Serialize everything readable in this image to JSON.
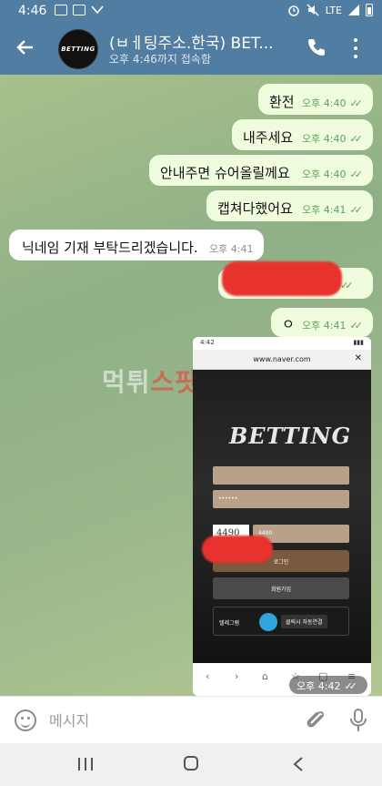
{
  "status_bar": {
    "time": "4:46",
    "network": "LTE",
    "icons": [
      "image-icon",
      "video-icon",
      "missed-call-icon",
      "alarm-icon",
      "mute-icon",
      "signal-icon",
      "battery-icon"
    ]
  },
  "header": {
    "title": "(ㅂㅔ팅주소.한국) BET...",
    "subtitle": "오후 4:46까지 접속함",
    "avatar_text": "BETTING",
    "accent": "#517da2"
  },
  "messages": [
    {
      "direction": "out",
      "text": "환전",
      "time": "오후 4:40",
      "read": true
    },
    {
      "direction": "out",
      "text": "내주세요",
      "time": "오후 4:40",
      "read": true
    },
    {
      "direction": "out",
      "text": "안내주면 슈어올릴께요",
      "time": "오후 4:40",
      "read": true
    },
    {
      "direction": "out",
      "text": "캡쳐다했어요",
      "time": "오후 4:41",
      "read": true
    },
    {
      "direction": "in",
      "text": "닉네임 기재 부탁드리겠습니다.",
      "time": "오후 4:41"
    },
    {
      "direction": "out",
      "text": "",
      "time": "",
      "read": true,
      "redacted": true
    },
    {
      "direction": "out",
      "text": "ㅇ",
      "time": "오후 4:41",
      "read": true
    }
  ],
  "image_message": {
    "time": "오후 4:42",
    "screenshot": {
      "status_time": "4:42",
      "url": "www.naver.com",
      "logo": "BETTING",
      "password_mask": "••••••",
      "captcha": "4490",
      "captcha_input": "4490",
      "login_label": "로그인",
      "join_label": "회원가입",
      "telegram_label": "텔레그램",
      "telegram_button": "클릭시 자동연결"
    }
  },
  "watermark": {
    "white": "먹튀",
    "red": "스팟"
  },
  "input": {
    "placeholder": "메시지"
  },
  "colors": {
    "outgoing_bubble": "#effdde",
    "incoming_bubble": "#ffffff",
    "check": "#5ea05a",
    "redaction": "#e8322d"
  }
}
